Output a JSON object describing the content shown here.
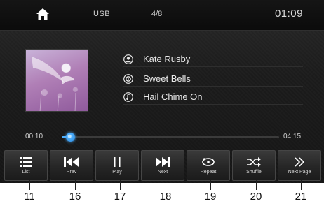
{
  "header": {
    "source": "USB",
    "track_count": "4/8",
    "clock": "01:09",
    "icons": {
      "home": "home-icon"
    }
  },
  "track": {
    "artist": "Kate Rusby",
    "album": "Sweet Bells",
    "title": "Hail Chime On",
    "icons": {
      "artist": "artist-icon",
      "album": "disc-icon",
      "title": "music-note-icon"
    }
  },
  "playback": {
    "elapsed": "00:10",
    "duration": "04:15",
    "progress_percent": 4
  },
  "controls": [
    {
      "key": "list",
      "label": "List",
      "icon": "list-icon"
    },
    {
      "key": "prev",
      "label": "Prev",
      "icon": "previous-icon"
    },
    {
      "key": "play",
      "label": "Play",
      "icon": "pause-icon"
    },
    {
      "key": "next",
      "label": "Next",
      "icon": "next-icon"
    },
    {
      "key": "repeat",
      "label": "Repeat",
      "icon": "repeat-icon"
    },
    {
      "key": "shuffle",
      "label": "Shuffle",
      "icon": "shuffle-icon"
    },
    {
      "key": "next_page",
      "label": "Next Page",
      "icon": "double-chevron-right-icon"
    }
  ],
  "callouts": [
    "11",
    "16",
    "17",
    "18",
    "19",
    "20",
    "21"
  ],
  "colors": {
    "accent": "#4fb0ff",
    "background": "#1c1c1c",
    "text": "#e8e8e8"
  }
}
